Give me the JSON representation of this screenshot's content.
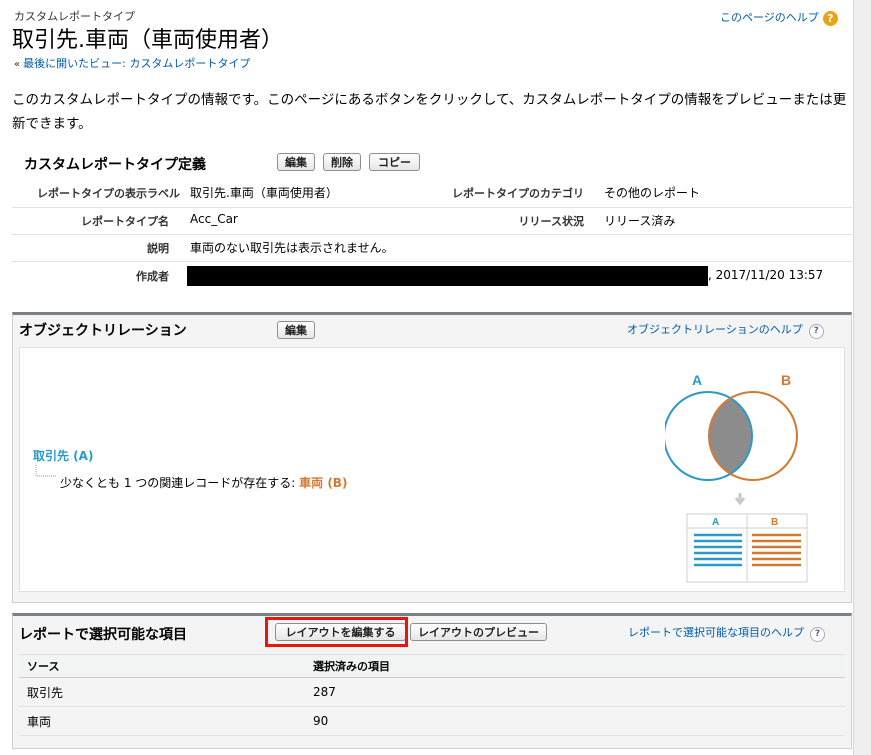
{
  "header": {
    "eyebrow": "カスタムレポートタイプ",
    "title": "取引先.車両（車両使用者）",
    "breadcrumb_prefix": "«",
    "breadcrumb": "最後に開いたビュー: カスタムレポートタイプ",
    "help_link": "このページのヘルプ",
    "help_icon": "?"
  },
  "description": "このカスタムレポートタイプの情報です。このページにあるボタンをクリックして、カスタムレポートタイプの情報をプレビューまたは更新できます。",
  "definition": {
    "title": "カスタムレポートタイプ定義",
    "buttons": {
      "edit": "編集",
      "delete": "削除",
      "copy": "コピー"
    },
    "fields": {
      "display_label_label": "レポートタイプの表示ラベル",
      "display_label_value": "取引先.車両（車両使用者）",
      "category_label": "レポートタイプのカテゴリ",
      "category_value": "その他のレポート",
      "name_label": "レポートタイプ名",
      "name_value": "Acc_Car",
      "release_label": "リリース状況",
      "release_value": "リリース済み",
      "desc_label": "説明",
      "desc_value": "車両のない取引先は表示されません。",
      "creator_label": "作成者",
      "creator_value": ", 2017/11/20 13:57"
    }
  },
  "relation": {
    "title": "オブジェクトリレーション",
    "edit_button": "編集",
    "help_link": "オブジェクトリレーションのヘルプ",
    "help_icon": "?",
    "object_a": "取引先 (A)",
    "child_text": "少なくとも 1 つの関連レコードが存在する:",
    "object_b": "車両 (B)",
    "venn_a": "A",
    "venn_b": "B",
    "table_a": "A",
    "table_b": "B",
    "colors": {
      "a": "#2b9ac7",
      "b": "#d27a33",
      "overlap": "#8c8c8c"
    }
  },
  "selectable": {
    "title": "レポートで選択可能な項目",
    "edit_layout_button": "レイアウトを編集する",
    "preview_layout_button": "レイアウトのプレビュー",
    "help_link": "レポートで選択可能な項目のヘルプ",
    "help_icon": "?",
    "columns": [
      "ソース",
      "選択済みの項目"
    ],
    "rows": [
      {
        "source": "取引先",
        "count": "287"
      },
      {
        "source": "車両",
        "count": "90"
      }
    ]
  }
}
